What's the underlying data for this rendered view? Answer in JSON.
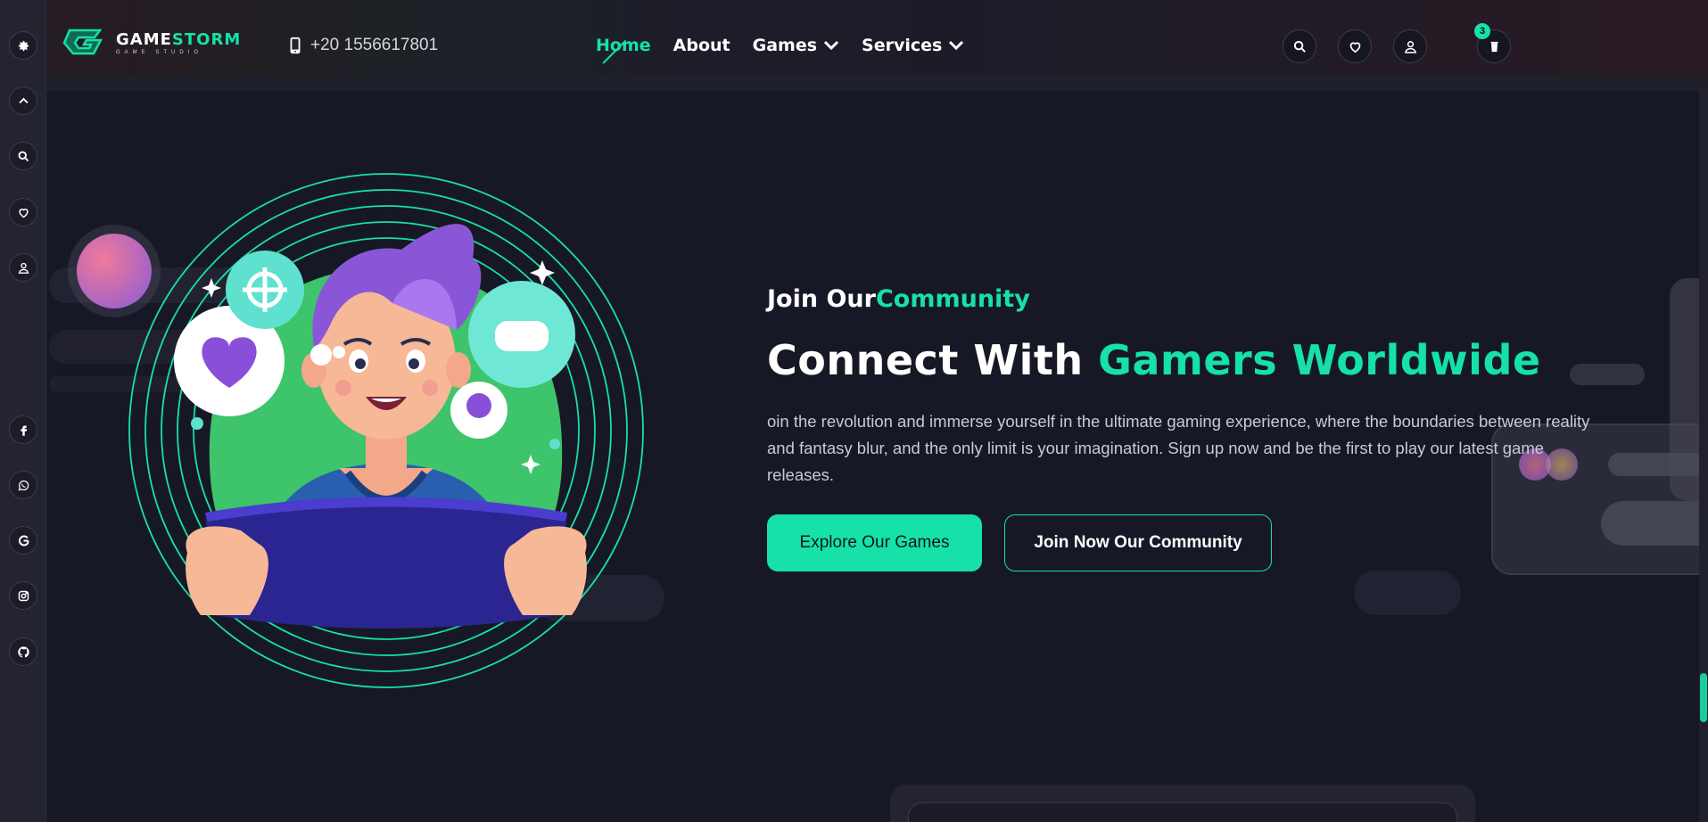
{
  "sidebar": {
    "icons": [
      {
        "name": "settings-gear-icon"
      },
      {
        "name": "scroll-up-chevron-icon"
      },
      {
        "name": "search-icon"
      },
      {
        "name": "heart-icon"
      },
      {
        "name": "user-icon"
      },
      {
        "name": "facebook-icon"
      },
      {
        "name": "whatsapp-icon"
      },
      {
        "name": "google-icon"
      },
      {
        "name": "instagram-icon"
      },
      {
        "name": "github-icon"
      }
    ]
  },
  "header": {
    "logo": {
      "main_a": "GAME",
      "main_b": "STORM",
      "sub": "GAME STUDIO"
    },
    "phone": "+20 1556617801",
    "nav": [
      {
        "label": "Home",
        "active": true
      },
      {
        "label": "About",
        "active": false
      },
      {
        "label": "Games",
        "dropdown": true
      },
      {
        "label": "Services",
        "dropdown": true
      }
    ],
    "cart_count": "3"
  },
  "hero": {
    "eyebrow_a": "Join Our",
    "eyebrow_b": "Community",
    "headline_a": "Connect With ",
    "headline_b": "Gamers Worldwide",
    "description": "oin the revolution and immerse yourself in the ultimate gaming experience, where the boundaries between reality and fantasy blur, and the only limit is your imagination. Sign up now and be the first to play our latest game releases.",
    "primary_button": "Explore Our Games",
    "secondary_button": "Join Now Our Community"
  },
  "colors": {
    "accent": "#16e1a8",
    "background": "#171826",
    "sidebar": "#23242f"
  }
}
